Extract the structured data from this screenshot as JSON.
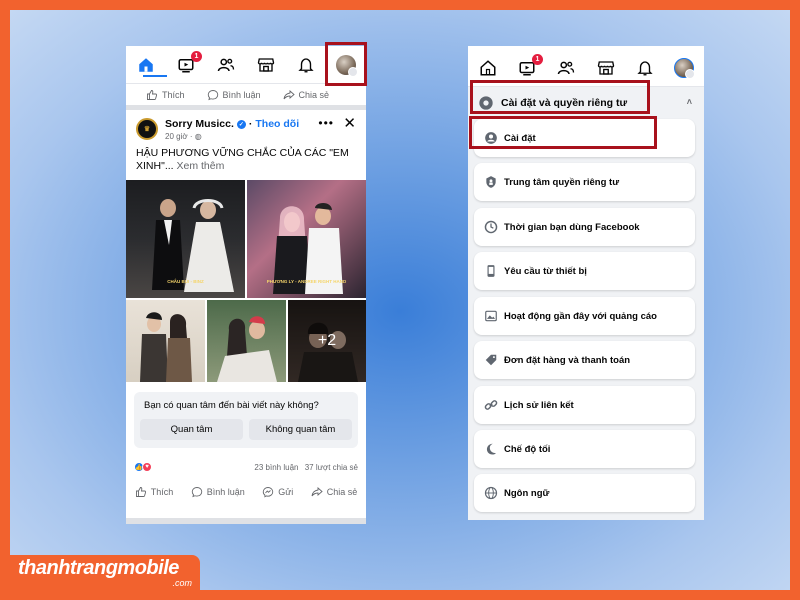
{
  "brand": {
    "name": "thanhtrangmobile",
    "tld": ".com"
  },
  "colors": {
    "accent": "#1877f2",
    "highlight_box": "#a8111c",
    "frame": "#f2622e",
    "badge": "#e41e3f"
  },
  "left_phone": {
    "nav": {
      "icons": [
        "home-icon",
        "video-icon",
        "friends-icon",
        "marketplace-icon",
        "bell-icon",
        "profile-avatar"
      ],
      "video_badge": "1"
    },
    "top_actions": {
      "like": "Thích",
      "comment": "Bình luận",
      "share": "Chia sẻ"
    },
    "post": {
      "page_name": "Sorry Musicc.",
      "follow": "Theo dõi",
      "time": "20 giờ",
      "time_icon": "globe-icon",
      "text": "HẬU PHƯƠNG VỮNG CHẮC CỦA CÁC \"EM XINH\"...",
      "see_more": "Xem thêm",
      "photo_captions": [
        "CHÂU BÙI - BINZ",
        "PHƯƠNG LY - ANDREE RIGHT HAND",
        "",
        "",
        ""
      ],
      "more_photos": "+2"
    },
    "interest": {
      "question": "Bạn có quan tâm đến bài viết này không?",
      "yes": "Quan tâm",
      "no": "Không quan tâm"
    },
    "stats": {
      "comments": "23 bình luận",
      "shares": "37 lượt chia sẻ"
    },
    "bottom_actions": {
      "like": "Thích",
      "comment": "Bình luận",
      "send": "Gửi",
      "share": "Chia sẻ"
    }
  },
  "right_phone": {
    "nav": {
      "video_badge": "1"
    },
    "section_title": "Cài đặt và quyền riêng tư",
    "items": [
      {
        "label": "Cài đặt",
        "icon": "user-circle-icon"
      },
      {
        "label": "Trung tâm quyền riêng tư",
        "icon": "privacy-lock-icon"
      },
      {
        "label": "Thời gian bạn dùng Facebook",
        "icon": "clock-icon"
      },
      {
        "label": "Yêu cầu từ thiết bị",
        "icon": "phone-icon"
      },
      {
        "label": "Hoạt động gần đây với quảng cáo",
        "icon": "ad-image-icon"
      },
      {
        "label": "Đơn đặt hàng và thanh toán",
        "icon": "tag-icon"
      },
      {
        "label": "Lịch sử liên kết",
        "icon": "link-icon"
      },
      {
        "label": "Chế độ tối",
        "icon": "moon-icon"
      },
      {
        "label": "Ngôn ngữ",
        "icon": "globe-icon"
      }
    ]
  }
}
